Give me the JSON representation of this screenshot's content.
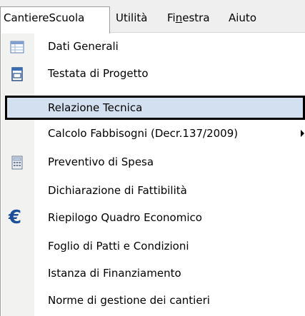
{
  "menubar": {
    "items": [
      {
        "label": "CantiereScuola"
      },
      {
        "label": "Utilità"
      },
      {
        "label_pre": "Fi",
        "label_ul": "n",
        "label_post": "estra"
      },
      {
        "label": "Aiuto"
      }
    ]
  },
  "menu": {
    "items": [
      {
        "label": "Dati Generali",
        "icon": "table-icon"
      },
      {
        "label": "Testata di Progetto",
        "icon": "document-icon"
      },
      {
        "label": "Relazione Tecnica",
        "selected": true
      },
      {
        "label": "Calcolo Fabbisogni (Decr.137/2009)",
        "has_submenu": true
      },
      {
        "label": "Preventivo di Spesa",
        "icon": "calculator-icon"
      },
      {
        "label": "Dichiarazione di Fattibilità"
      },
      {
        "label": "Riepilogo Quadro Economico",
        "icon": "euro-icon",
        "icon_glyph": "€"
      },
      {
        "label": "Foglio di Patti e Condizioni"
      },
      {
        "label": "Istanza di Finanziamento"
      },
      {
        "label": "Norme di gestione dei cantieri"
      }
    ]
  },
  "colors": {
    "selection_bg": "#d3e0ef",
    "euro": "#1b4f9c",
    "menubar_bg": "#efefef"
  }
}
